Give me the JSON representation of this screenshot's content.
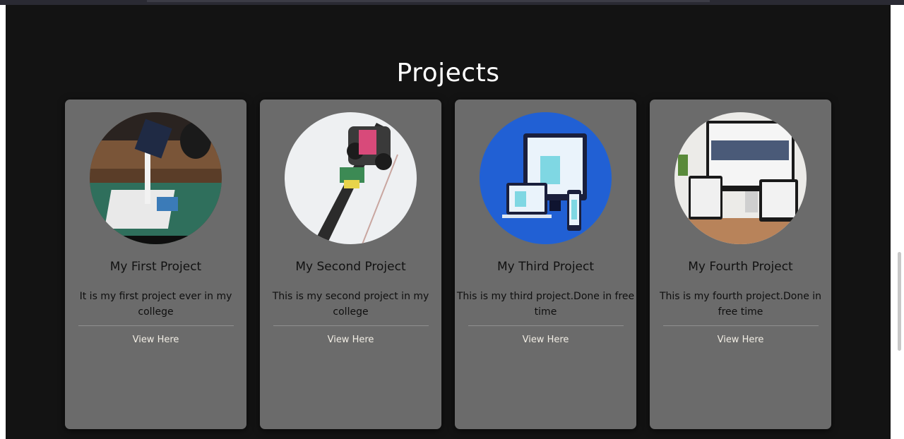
{
  "section": {
    "title": "Projects"
  },
  "projects": [
    {
      "title": "My First Project",
      "description": "It is my first project ever in my college",
      "link_label": "View Here",
      "image_icon": "solar-tracker-photo"
    },
    {
      "title": "My Second Project",
      "description": "This is my second project in my college",
      "link_label": "View Here",
      "image_icon": "line-follower-robot-photo"
    },
    {
      "title": "My Third Project",
      "description": "This is my third project.Done in free time",
      "link_label": "View Here",
      "image_icon": "responsive-devices-illustration"
    },
    {
      "title": "My Fourth Project",
      "description": "This is my fourth project.Done in free time",
      "link_label": "View Here",
      "image_icon": "responsive-website-mockup"
    }
  ],
  "colors": {
    "page_bg": "#131313",
    "card_bg": "#6b6b6b",
    "title_text": "#ffffff",
    "card_text": "#111111",
    "link_text": "#f1ede4"
  }
}
